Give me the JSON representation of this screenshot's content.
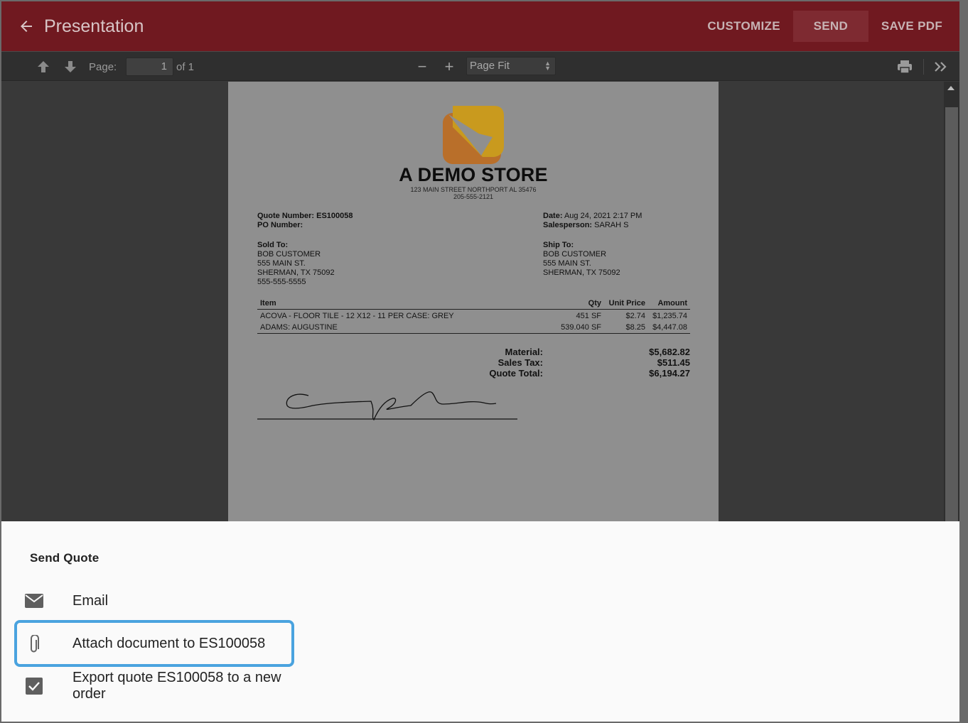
{
  "header": {
    "title": "Presentation",
    "back_icon": "arrow-left-icon",
    "actions": [
      {
        "label": "CUSTOMIZE",
        "active": false
      },
      {
        "label": "SEND",
        "active": true
      },
      {
        "label": "SAVE PDF",
        "active": false
      }
    ],
    "bg_color": "#701920"
  },
  "viewer_toolbar": {
    "page_label": "Page:",
    "page_value": "1",
    "page_total": "of 1",
    "zoom_out": "−",
    "zoom_in": "+",
    "zoom_value": "Page Fit",
    "icons": [
      "page-up-icon",
      "page-down-icon",
      "zoom-out-icon",
      "zoom-in-icon",
      "print-icon",
      "more-tools-icon"
    ]
  },
  "document": {
    "store_name": "A DEMO STORE",
    "address_line1": "123 MAIN STREET NORTHPORT AL 35476",
    "address_line2": "205-555-2121",
    "quote_number_label": "Quote Number:",
    "quote_number": "ES100058",
    "po_number_label": "PO Number:",
    "date_label": "Date:",
    "date": "Aug 24, 2021 2:17 PM",
    "salesperson_label": "Salesperson:",
    "salesperson": "SARAH S",
    "sold_to_label": "Sold To:",
    "sold_to": [
      "BOB CUSTOMER",
      "555 MAIN ST.",
      "SHERMAN, TX 75092",
      "555-555-5555"
    ],
    "ship_to_label": "Ship To:",
    "ship_to": [
      "BOB CUSTOMER",
      "555 MAIN ST.",
      "SHERMAN, TX 75092"
    ],
    "columns": {
      "item": "Item",
      "qty": "Qty",
      "unit_price": "Unit Price",
      "amount": "Amount"
    },
    "items": [
      {
        "item": "ACOVA - FLOOR TILE - 12 X12 - 11 PER CASE: GREY",
        "qty": "451 SF",
        "unit_price": "$2.74",
        "amount": "$1,235.74"
      },
      {
        "item": "ADAMS: AUGUSTINE",
        "qty": "539.040 SF",
        "unit_price": "$8.25",
        "amount": "$4,447.08"
      }
    ],
    "totals": {
      "material_label": "Material:",
      "material": "$5,682.82",
      "sales_tax_label": "Sales Tax:",
      "sales_tax": "$511.45",
      "quote_total_label": "Quote Total:",
      "quote_total": "$6,194.27"
    },
    "logo_colors": [
      "#b96f2a",
      "#c99a1e"
    ]
  },
  "send_sheet": {
    "title": "Send Quote",
    "options": [
      {
        "label": "Email",
        "icon": "mail-icon",
        "focused": false
      },
      {
        "label": "Attach document to ES100058",
        "icon": "paperclip-icon",
        "focused": true
      },
      {
        "label": "Export quote ES100058 to a new order",
        "icon": "checkbox-checked-icon",
        "focused": false
      }
    ],
    "focus_color": "#4aa3df"
  }
}
